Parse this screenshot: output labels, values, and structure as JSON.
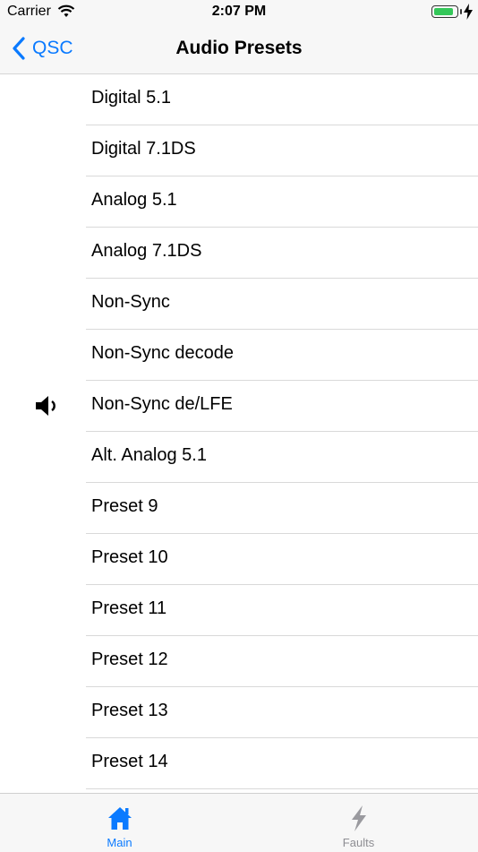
{
  "status_bar": {
    "carrier": "Carrier",
    "time": "2:07 PM",
    "battery_level": 0.9,
    "charging": true,
    "battery_color": "#34c759"
  },
  "nav": {
    "back_label": "QSC",
    "title": "Audio Presets",
    "accent_color": "#0a7aff"
  },
  "presets": {
    "active_index": 6,
    "active_icon": "speaker-icon",
    "items": [
      "Digital 5.1",
      "Digital 7.1DS",
      "Analog 5.1",
      "Analog 7.1DS",
      "Non-Sync",
      "Non-Sync decode",
      "Non-Sync de/LFE",
      "Alt. Analog 5.1",
      "Preset 9",
      "Preset 10",
      "Preset 11",
      "Preset 12",
      "Preset 13",
      "Preset 14"
    ]
  },
  "tab_bar": {
    "tabs": [
      {
        "label": "Main",
        "icon": "home-icon",
        "selected": true
      },
      {
        "label": "Faults",
        "icon": "bolt-icon",
        "selected": false
      }
    ]
  }
}
